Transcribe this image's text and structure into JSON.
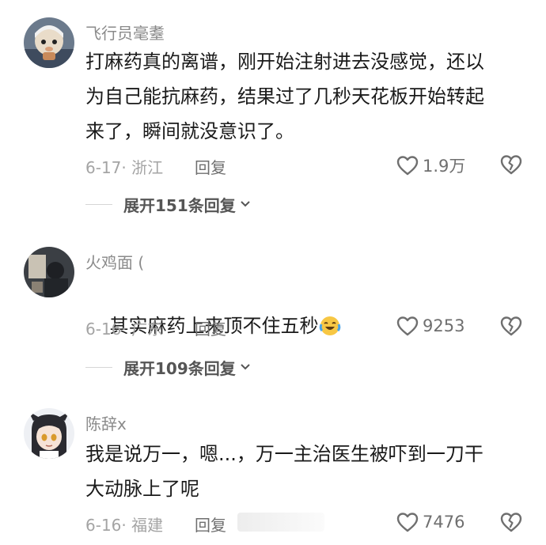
{
  "comments": [
    {
      "username": "飞行员毫耋",
      "text": "打麻药真的离谱，刚开始注射进去没感觉，还以\n为自己能抗麻药，结果过了几秒天花板开始转起\n来了，瞬间就没意识了。",
      "date": "6-17",
      "location": "浙江",
      "reply_label": "回复",
      "likes": "1.9万",
      "expand_label": "展开151条回复"
    },
    {
      "username": "火鸡面 (",
      "text": "其实麻药上来顶不住五秒",
      "emoji": "crying-laughing-emoji",
      "date": "6-16",
      "location": "广东",
      "reply_label": "回复",
      "likes": "9253",
      "expand_label": "展开109条回复"
    },
    {
      "username": "陈辞x",
      "text": "我是说万一，嗯...，万一主治医生被吓到一刀干\n大动脉上了呢",
      "date": "6-16",
      "location": "福建",
      "reply_label": "回复",
      "likes": "7476"
    }
  ],
  "icons": {
    "like": "heart-outline-icon",
    "dislike": "broken-heart-icon",
    "expand": "chevron-down-icon"
  },
  "colors": {
    "text": "#1a1a1a",
    "meta": "#a4a4a4",
    "username": "#8a8a8a"
  }
}
